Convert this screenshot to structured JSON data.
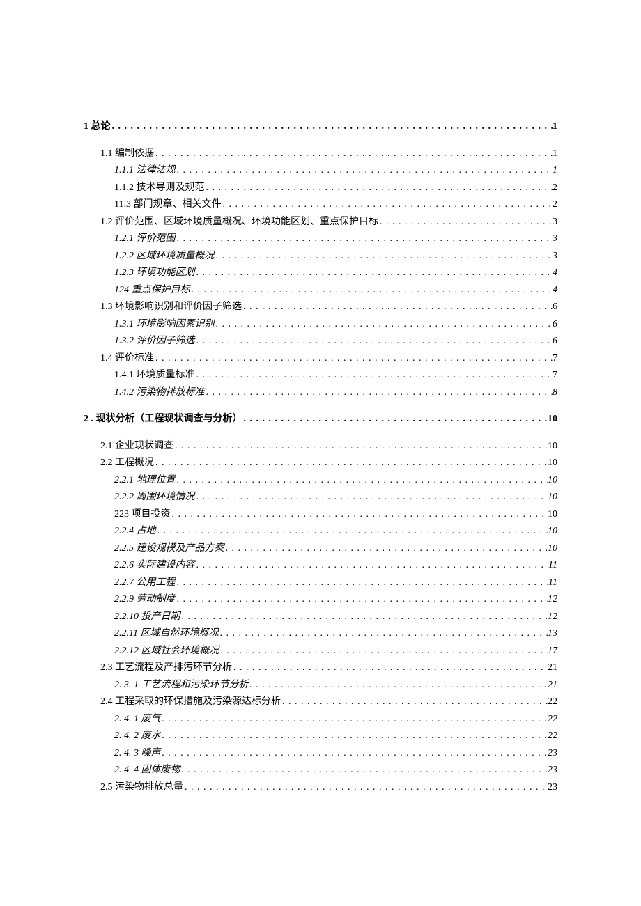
{
  "toc": [
    {
      "level": 1,
      "label": "1 总论",
      "page": "1",
      "italic": false,
      "gap": false
    },
    {
      "level": 2,
      "label": "1.1  编制依据",
      "page": "1",
      "italic": false,
      "gap": true
    },
    {
      "level": 3,
      "label": "1.1.1  法律法规",
      "page": "1",
      "italic": true,
      "gap": false
    },
    {
      "level": 3,
      "label": "1.1.2  技术导则及规范",
      "page": "2",
      "italic": false,
      "gap": false
    },
    {
      "level": 3,
      "label": "11.3 部门规章、相关文件",
      "page": "2",
      "italic": false,
      "gap": false
    },
    {
      "level": 2,
      "label": "1.2  评价范围、区域环境质量概况、环境功能区划、重点保护目标",
      "page": "3",
      "italic": false,
      "gap": false
    },
    {
      "level": 3,
      "label": "1.2.1  评价范围",
      "page": "3",
      "italic": true,
      "gap": false
    },
    {
      "level": 3,
      "label": "1.2.2  区域环境质量概况",
      "page": "3",
      "italic": true,
      "gap": false
    },
    {
      "level": 3,
      "label": "1.2.3  环境功能区划",
      "page": "4",
      "italic": true,
      "gap": false
    },
    {
      "level": 3,
      "label": "124 重点保护目标",
      "page": "4",
      "italic": true,
      "gap": false
    },
    {
      "level": 2,
      "label": "1.3  环境影响识别和评价因子筛选",
      "page": "6",
      "italic": false,
      "gap": false
    },
    {
      "level": 3,
      "label": "1.3.1  环境影响因素识别",
      "page": "6",
      "italic": true,
      "gap": false
    },
    {
      "level": 3,
      "label": "1.3.2  评价因子筛选",
      "page": "6",
      "italic": true,
      "gap": false
    },
    {
      "level": 2,
      "label": "1.4  评价标准",
      "page": "7",
      "italic": false,
      "gap": false
    },
    {
      "level": 3,
      "label": "1.4.1  环境质量标准",
      "page": "7",
      "italic": false,
      "gap": false
    },
    {
      "level": 3,
      "label": "1.4.2  污染物排放标准",
      "page": "8",
      "italic": true,
      "gap": false
    },
    {
      "level": 1,
      "label": "2    . 现状分析（工程现状调查与分析）",
      "page": "10",
      "italic": false,
      "gap": true
    },
    {
      "level": 2,
      "label": "2.1  企业现状调查",
      "page": "10",
      "italic": false,
      "gap": true
    },
    {
      "level": 2,
      "label": "2.2  工程概况",
      "page": "10",
      "italic": false,
      "gap": false
    },
    {
      "level": 3,
      "label": "2.2.1  地理位置",
      "page": "10",
      "italic": true,
      "gap": false
    },
    {
      "level": 3,
      "label": "2.2.2  周围环境情况",
      "page": "10",
      "italic": true,
      "gap": false
    },
    {
      "level": 3,
      "label": "223 项目投资",
      "page": "10",
      "italic": false,
      "gap": false
    },
    {
      "level": 3,
      "label": "2.2.4   占地",
      "page": "10",
      "italic": true,
      "gap": false
    },
    {
      "level": 3,
      "label": "2.2.5   建设规模及产品方案",
      "page": "10",
      "italic": true,
      "gap": false
    },
    {
      "level": 3,
      "label": "2.2.6   实际建设内容",
      "page": "11",
      "italic": true,
      "gap": false
    },
    {
      "level": 3,
      "label": "2.2.7   公用工程",
      "page": "11",
      "italic": true,
      "gap": false
    },
    {
      "level": 3,
      "label": "2.2.9  劳动制度",
      "page": "12",
      "italic": true,
      "gap": false
    },
    {
      "level": 3,
      "label": "2.2.10   投产日期",
      "page": "12",
      "italic": true,
      "gap": false
    },
    {
      "level": 3,
      "label": "2.2.11   区域自然环境概况",
      "page": "13",
      "italic": true,
      "gap": false
    },
    {
      "level": 3,
      "label": "2.2.12   区域社会环境概况",
      "page": "17",
      "italic": true,
      "gap": false
    },
    {
      "level": 2,
      "label": "2.3  工艺流程及产排污环节分析",
      "page": "21",
      "italic": false,
      "gap": false
    },
    {
      "level": 3,
      "label": "2. 3. 1 工艺流程和污染环节分析",
      "page": "21",
      "italic": true,
      "gap": false,
      "fk": true
    },
    {
      "level": 2,
      "label": "2.4  工程采取的环保措施及污染源达标分析",
      "page": "22",
      "italic": false,
      "gap": false
    },
    {
      "level": 3,
      "label": "2. 4. 1 废气",
      "page": "22",
      "italic": true,
      "gap": false,
      "fk": true
    },
    {
      "level": 3,
      "label": "2. 4. 2 废水",
      "page": "22",
      "italic": true,
      "gap": false,
      "fk": true
    },
    {
      "level": 3,
      "label": "2. 4. 3 噪声",
      "page": "23",
      "italic": true,
      "gap": false,
      "fk": true
    },
    {
      "level": 3,
      "label": "2. 4. 4 固体废物",
      "page": "23",
      "italic": true,
      "gap": false,
      "fk": true
    },
    {
      "level": 2,
      "label": "2.5  污染物排放总量",
      "page": "23",
      "italic": false,
      "gap": false
    }
  ]
}
